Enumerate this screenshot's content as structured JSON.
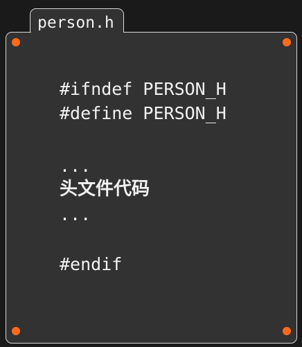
{
  "file_tab": {
    "label": "person.h"
  },
  "code": {
    "line1": "#ifndef PERSON_H",
    "line2": "#define PERSON_H",
    "line3": "...",
    "line4": "头文件代码",
    "line5": "...",
    "line6": "#endif"
  },
  "colors": {
    "background": "#1a1a1a",
    "panel": "#323232",
    "border": "#d8d8d8",
    "corner_dot": "#ff6a1a",
    "text": "#f2f2f2"
  }
}
